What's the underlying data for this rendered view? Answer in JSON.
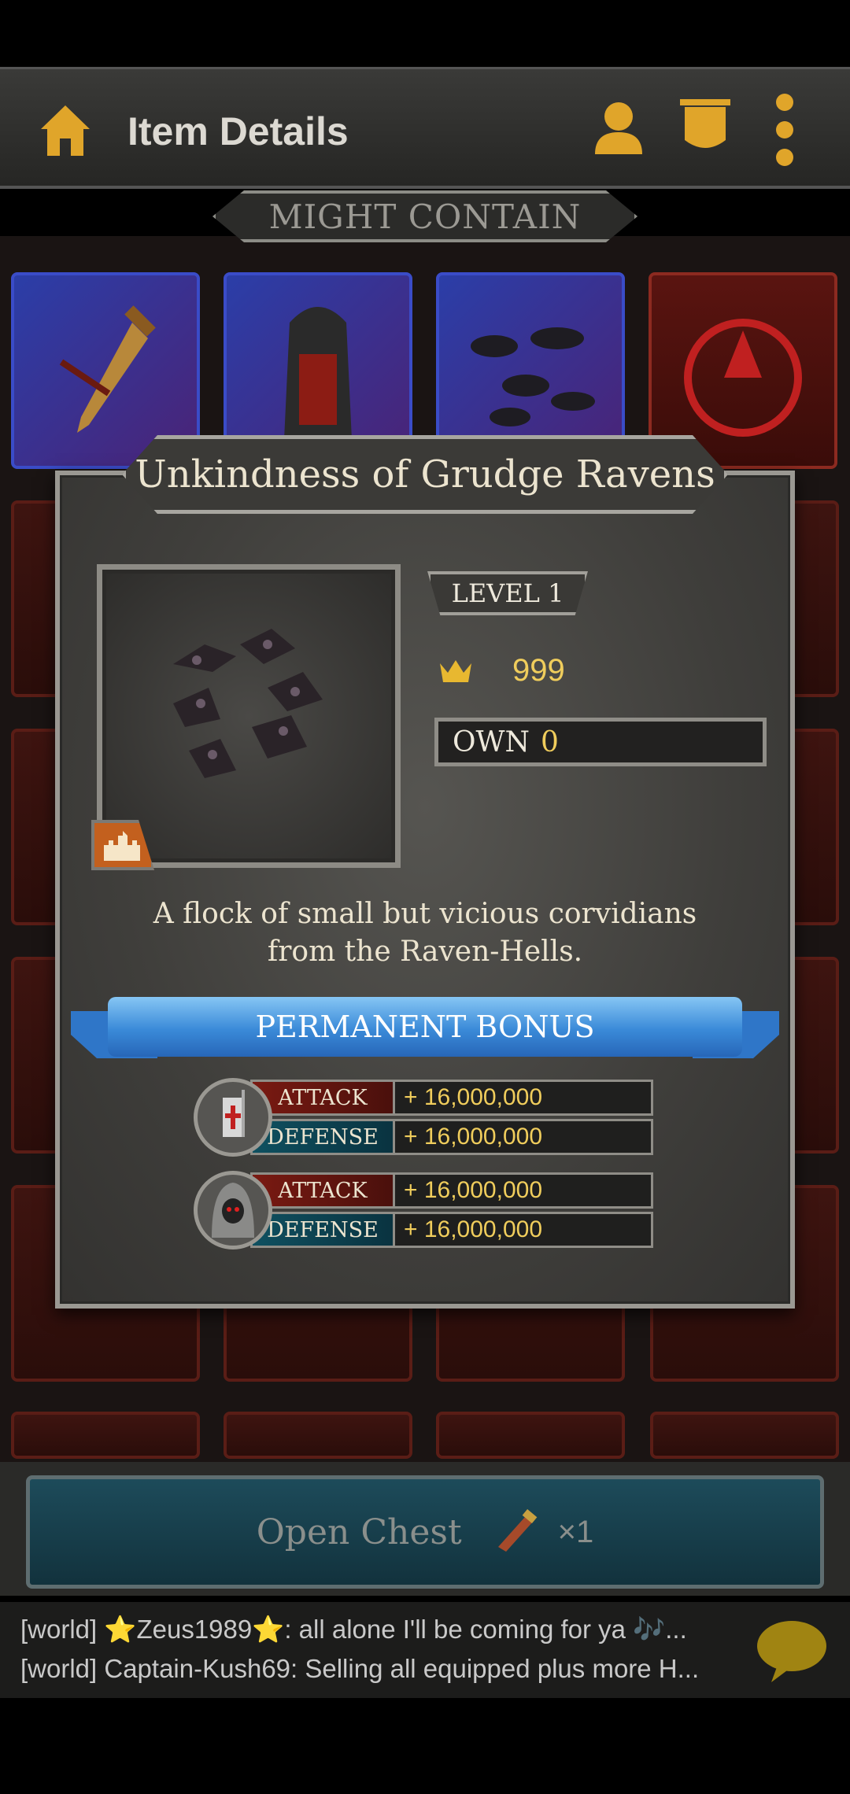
{
  "header": {
    "title": "Item Details",
    "icons": [
      "home-icon",
      "profile-icon",
      "bulletin-icon",
      "more-icon"
    ]
  },
  "section": {
    "might_contain": "MIGHT CONTAIN"
  },
  "modal": {
    "title": "Unkindness of Grudge Ravens",
    "level": "LEVEL 1",
    "price": "999",
    "own_label": "OWN",
    "own_value": "0",
    "description_line1": "A flock of small but vicious corvidians",
    "description_line2": "from the Raven-Hells.",
    "bonus_header": "PERMANENT BONUS",
    "bonuses": [
      {
        "troop": "knight",
        "attack_label": "ATTACK",
        "attack_value": "+ 16,000,000",
        "defense_label": "DEFENSE",
        "defense_value": "+ 16,000,000"
      },
      {
        "troop": "hooded",
        "attack_label": "ATTACK",
        "attack_value": "+ 16,000,000",
        "defense_label": "DEFENSE",
        "defense_value": "+ 16,000,000"
      }
    ]
  },
  "chest": {
    "label": "Open Chest",
    "multiplier": "×1"
  },
  "chat": {
    "line1": "[world] ⭐Zeus1989⭐: all alone I'll be coming for ya 🎶...",
    "line2": "[world] Captain-Kush69: Selling all equipped plus more H..."
  },
  "colors": {
    "gold": "#f0cd5c",
    "cream": "#ece4cf",
    "ribbon": "#3a8ad8"
  }
}
